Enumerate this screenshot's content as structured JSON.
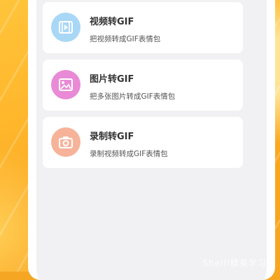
{
  "menu": {
    "items": [
      {
        "title": "视频转GIF",
        "desc": "把视频转成GIF表情包",
        "icon": "film-icon",
        "color": "#a9d7f6"
      },
      {
        "title": "图片转GIF",
        "desc": "把多张图片转成GIF表情包",
        "icon": "image-icon",
        "color": "#e98ad6"
      },
      {
        "title": "录制转GIF",
        "desc": "录制视频转成GIF表情包",
        "icon": "camera-icon",
        "color": "#f7b39a"
      }
    ]
  },
  "watermark": "Shelfl精英学习网"
}
